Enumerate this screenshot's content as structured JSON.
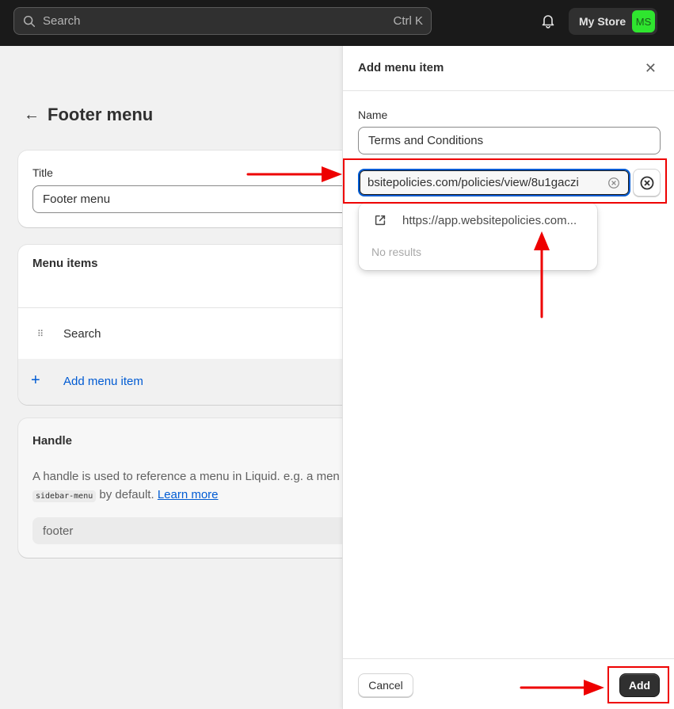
{
  "topbar": {
    "search_placeholder": "Search",
    "search_shortcut": "Ctrl K",
    "store_name": "My Store",
    "store_initials": "MS",
    "avatar_color": "#2fe52f"
  },
  "page": {
    "title": "Footer menu",
    "title_card": {
      "label": "Title",
      "value": "Footer menu"
    },
    "menu_items_card": {
      "heading": "Menu items",
      "items": [
        {
          "label": "Search"
        }
      ],
      "add_label": "Add menu item"
    },
    "handle_card": {
      "heading": "Handle",
      "help_text": "A handle is used to reference a menu in Liquid. e.g. a men",
      "help_code": "sidebar-menu",
      "help_suffix": " by default. ",
      "learn_more": "Learn more",
      "value": "footer"
    }
  },
  "drawer": {
    "title": "Add menu item",
    "name_label": "Name",
    "name_value": "Terms and Conditions",
    "link_value": "bsitepolicies.com/policies/view/8u1gaczi",
    "suggestion": "https://app.websitepolicies.com...",
    "no_results": "No results",
    "cancel_label": "Cancel",
    "add_label": "Add"
  },
  "colors": {
    "accent": "#005bd3",
    "annotation": "#ee0000",
    "primary_button": "#303030"
  }
}
